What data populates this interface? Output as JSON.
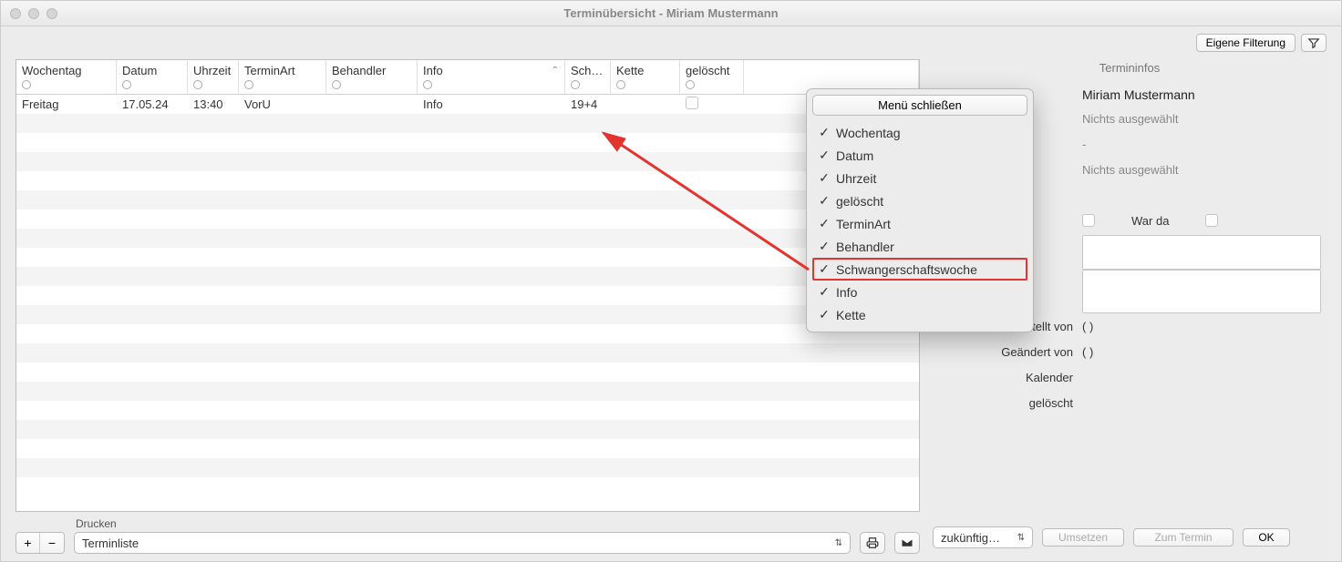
{
  "title": "Terminübersicht - Miriam Mustermann",
  "toolbar": {
    "filter_button": "Eigene Filterung"
  },
  "columns": {
    "wochentag": "Wochentag",
    "datum": "Datum",
    "uhrzeit": "Uhrzeit",
    "terminart": "TerminArt",
    "behandler": "Behandler",
    "info": "Info",
    "sch": "Sch…",
    "kette": "Kette",
    "geloescht": "gelöscht"
  },
  "row": {
    "wochentag": "Freitag",
    "datum": "17.05.24",
    "uhrzeit": "13:40",
    "terminart": "VorU",
    "behandler": "",
    "info": "Info",
    "sch": "19+4",
    "kette": "",
    "geloescht": ""
  },
  "menu": {
    "close": "Menü schließen",
    "items": {
      "wochentag": "Wochentag",
      "datum": "Datum",
      "uhrzeit": "Uhrzeit",
      "geloescht": "gelöscht",
      "terminart": "TerminArt",
      "behandler": "Behandler",
      "schwanger": "Schwangerschaftswoche",
      "info": "Info",
      "kette": "Kette"
    }
  },
  "sidebar": {
    "header": "Termininfos",
    "patient": "Miriam Mustermann",
    "nothing": "Nichts ausgewählt",
    "dash": "-",
    "war_da": "War da",
    "erstellt_von": "Erstellt von",
    "geaendert_von": "Geändert von",
    "kalender": "Kalender",
    "geloescht": "gelöscht",
    "paren": "( )"
  },
  "bottom": {
    "drucken_label": "Drucken",
    "drucken_value": "Terminliste",
    "zukuenftig": "zukünftig…",
    "umsetzen": "Umsetzen",
    "zum_termin": "Zum Termin",
    "ok": "OK"
  }
}
